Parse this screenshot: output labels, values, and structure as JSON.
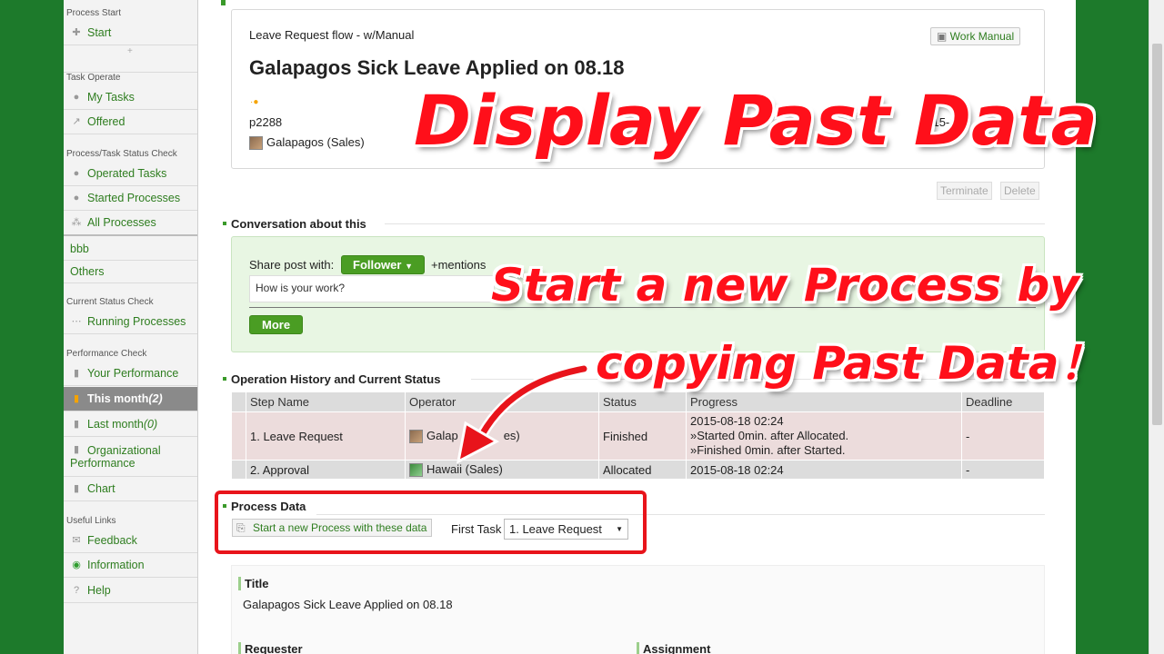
{
  "sidebar": {
    "process_start_head": "Process Start",
    "start": "Start",
    "divider_plus": "+",
    "task_operate_head": "Task Operate",
    "my_tasks": "My Tasks",
    "offered": "Offered",
    "status_check_head": "Process/Task Status Check",
    "operated_tasks": "Operated Tasks",
    "started_processes": "Started Processes",
    "all_processes": "All Processes",
    "bbb": "bbb",
    "others": "Others",
    "current_status_head": "Current Status Check",
    "running_processes": "Running Processes",
    "performance_head": "Performance Check",
    "your_performance": "Your Performance",
    "this_month": "This month",
    "this_month_count": "(2)",
    "last_month": "Last month",
    "last_month_count": "(0)",
    "org_performance_1": "Organizational",
    "org_performance_2": "Performance",
    "chart": "Chart",
    "useful_links_head": "Useful Links",
    "feedback": "Feedback",
    "information": "Information",
    "help": "Help"
  },
  "process": {
    "flow_name": "Leave Request flow - w/Manual",
    "work_manual": "Work Manual",
    "title": "Galapagos Sick Leave Applied on 08.18",
    "process_id": "p2288",
    "date_partial": "2015",
    "date_partial2": "-1",
    "requester": "Galapagos (Sales)",
    "terminate": "Terminate",
    "delete": "Delete"
  },
  "conversation": {
    "heading": "Conversation about this",
    "share_with": "Share post with:",
    "follower": "Follower",
    "mentions": "+mentions",
    "post_text": "How is your work?",
    "more": "More"
  },
  "history": {
    "heading": "Operation History and Current Status",
    "columns": [
      "Step Name",
      "Operator",
      "Status",
      "Progress",
      "Deadline"
    ],
    "rows": [
      {
        "step": "1. Leave Request",
        "operator_a": "Galap",
        "operator_b": "es)",
        "status": "Finished",
        "progress": [
          "2015-08-18 02:24",
          "»Started 0min. after Allocated.",
          "»Finished 0min. after Started."
        ],
        "deadline": "-"
      },
      {
        "step": "2. Approval",
        "operator": "Hawaii (Sales)",
        "status": "Allocated",
        "progress": [
          "2015-08-18 02:24"
        ],
        "deadline": "-"
      }
    ]
  },
  "process_data": {
    "heading": "Process Data",
    "start_new": "Start a new Process with these data",
    "first_task_label": "First Task",
    "first_task_value": "1. Leave Request"
  },
  "detail": {
    "title_label": "Title",
    "title_value": "Galapagos Sick Leave Applied on 08.18",
    "requester_label": "Requester",
    "assignment_label": "Assignment"
  },
  "overlay": {
    "headline": "Display Past Data",
    "sub1": "Start a new Process by",
    "sub2": "copying Past Data！"
  },
  "colors": {
    "accent_green": "#4a9d23",
    "overlay_red": "#ff0f1a"
  }
}
